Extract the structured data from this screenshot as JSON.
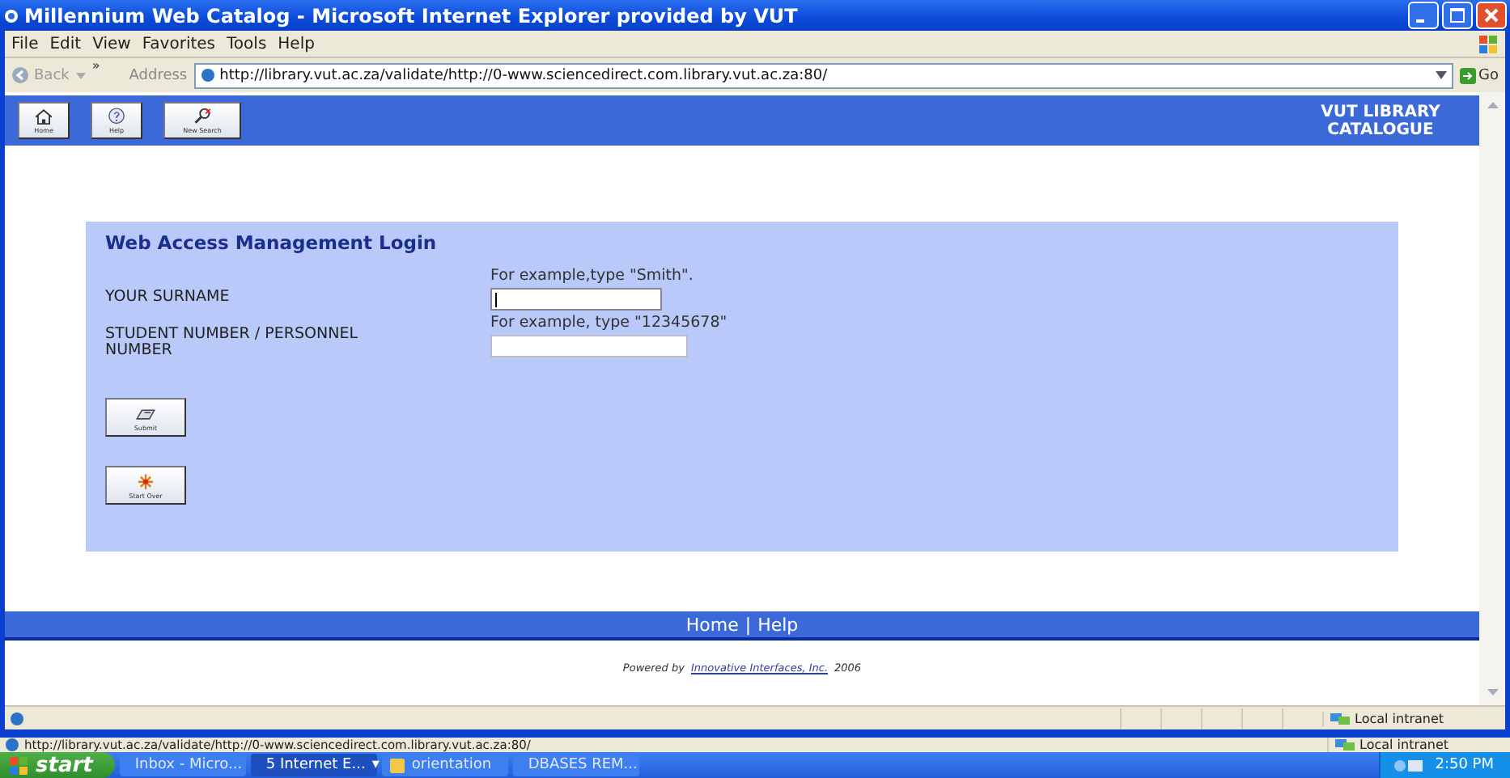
{
  "window": {
    "title": "Millennium Web Catalog - Microsoft Internet Explorer provided by VUT"
  },
  "menu": [
    "File",
    "Edit",
    "View",
    "Favorites",
    "Tools",
    "Help"
  ],
  "address_bar": {
    "back": "Back",
    "chevron": "»",
    "label": "Address",
    "url": "http://library.vut.ac.za/validate/http://0-www.sciencedirect.com.library.vut.ac.za:80/",
    "go": "Go"
  },
  "page_header": {
    "buttons": [
      {
        "kind": "home",
        "label": "Home"
      },
      {
        "kind": "help",
        "label": "Help"
      },
      {
        "kind": "search",
        "label": "New Search"
      }
    ],
    "title": "VUT LIBRARY CATALOGUE"
  },
  "form": {
    "title": "Web Access Management Login",
    "fields": [
      {
        "label": "YOUR SURNAME",
        "hint": "For example,type \"Smith\".",
        "focused": true
      },
      {
        "label": "STUDENT NUMBER / PERSONNEL NUMBER",
        "hint": "For example, type \"12345678\"",
        "focused": false
      }
    ],
    "buttons": [
      {
        "kind": "submit",
        "label": "Submit"
      },
      {
        "kind": "reset",
        "label": "Start Over"
      }
    ]
  },
  "footer": {
    "links": [
      "Home",
      "Help"
    ],
    "separator": "|",
    "powered_by": "Powered by",
    "company_link": "Innovative Interfaces, Inc.",
    "year": "2006"
  },
  "status_bar": {
    "zone": "Local intranet"
  },
  "outer_status_bar": {
    "url": "http://library.vut.ac.za/validate/http://0-www.sciencedirect.com.library.vut.ac.za:80/",
    "zone": "Local intranet"
  },
  "taskbar": {
    "start": "start",
    "tasks": [
      {
        "label": "Inbox - Micro...",
        "selected": false
      },
      {
        "label": "5 Internet E...",
        "selected": true,
        "menu": "▾"
      },
      {
        "label": "orientation",
        "selected": false
      },
      {
        "label": "DBASES REM...",
        "selected": false
      }
    ],
    "clock": "2:50 PM"
  }
}
